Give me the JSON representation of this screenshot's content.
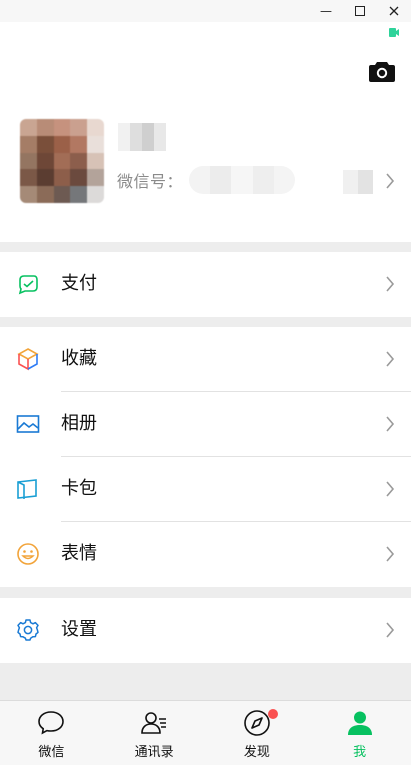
{
  "window": {
    "minimize_icon": "minimize-icon",
    "maximize_icon": "maximize-icon",
    "close_icon": "close-icon"
  },
  "profile": {
    "wechat_id_label": "微信号：",
    "camera_icon": "camera-icon"
  },
  "menu": {
    "pay": {
      "label": "支付",
      "icon": "wallet-check-icon"
    },
    "favorites": {
      "label": "收藏",
      "icon": "cube-icon"
    },
    "album": {
      "label": "相册",
      "icon": "photo-icon"
    },
    "cards": {
      "label": "卡包",
      "icon": "card-icon"
    },
    "stickers": {
      "label": "表情",
      "icon": "smiley-icon"
    },
    "settings": {
      "label": "设置",
      "icon": "gear-icon"
    }
  },
  "tabs": [
    {
      "label": "微信",
      "icon": "chat-bubble-icon",
      "active": false
    },
    {
      "label": "通讯录",
      "icon": "contacts-icon",
      "active": false
    },
    {
      "label": "发现",
      "icon": "compass-icon",
      "active": false,
      "badge": true
    },
    {
      "label": "我",
      "icon": "person-icon",
      "active": true
    }
  ],
  "colors": {
    "accent": "#07c160",
    "badge": "#fa5151",
    "favorites_blue": "#2e7cf6",
    "album_blue": "#1a7ad4",
    "stickers_orange": "#f2a43a"
  }
}
